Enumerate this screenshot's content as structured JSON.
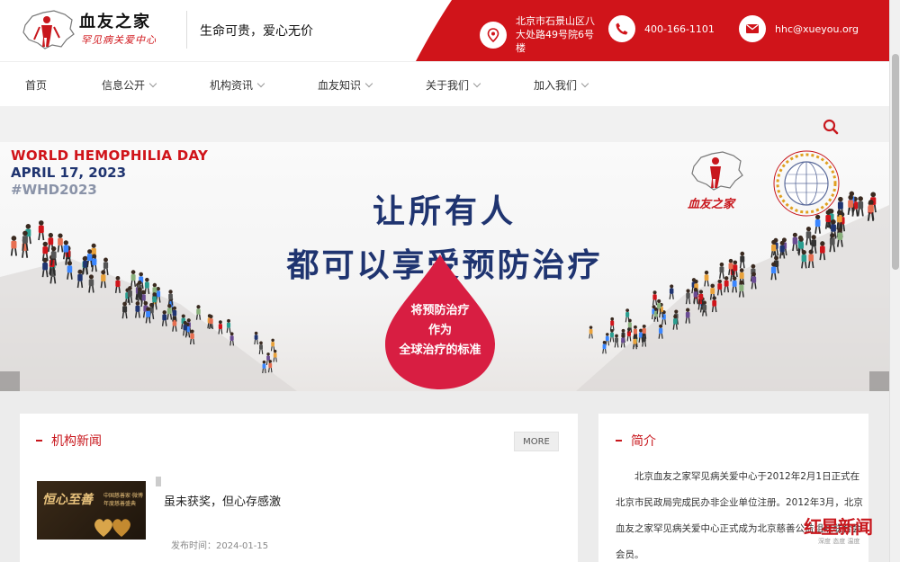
{
  "header": {
    "logo_name": "血友之家",
    "logo_sub": "罕见病关爱中心",
    "slogan": "生命可贵，爱心无价",
    "address": "北京市石景山区八大处路49号院6号楼",
    "phone": "400-166-1101",
    "email": "hhc@xueyou.org",
    "brand_color": "#d0141a"
  },
  "nav": {
    "items": [
      {
        "label": "首页",
        "has_dropdown": false
      },
      {
        "label": "信息公开",
        "has_dropdown": true
      },
      {
        "label": "机构资讯",
        "has_dropdown": true
      },
      {
        "label": "血友知识",
        "has_dropdown": true
      },
      {
        "label": "关于我们",
        "has_dropdown": true
      },
      {
        "label": "加入我们",
        "has_dropdown": true
      }
    ]
  },
  "banner": {
    "event_line1": "WORLD HEMOPHILIA DAY",
    "event_line2": "APRIL 17, 2023",
    "event_line3": "#WHD2023",
    "headline1": "让所有人",
    "headline2": "都可以享受预防治疗",
    "drop_line1": "将预防治疗",
    "drop_line2": "作为",
    "drop_line3": "全球治疗的标准",
    "brand_name": "血友之家",
    "globe_text": "WORLD HEMOPHILIA DAY · APRIL 17",
    "arrow_left": "‹",
    "arrow_right": "›"
  },
  "news": {
    "title": "机构新闻",
    "more_label": "MORE",
    "items": [
      {
        "thumb_title": "恒心至善",
        "thumb_sub": "中国慈善家·微博年度慈善盛典",
        "title": "虽未获奖，但心存感激",
        "date": "发布时间：2024-01-15"
      }
    ]
  },
  "intro": {
    "title": "简介",
    "text": "北京血友之家罕见病关爱中心于2012年2月1日正式在北京市民政局完成民办非企业单位注册。2012年3月，北京血友之家罕见病关爱中心正式成为北京慈善公益组织联合会会员。"
  },
  "watermark": {
    "main": "红星新闻",
    "sub": "深度 态度 温度"
  }
}
